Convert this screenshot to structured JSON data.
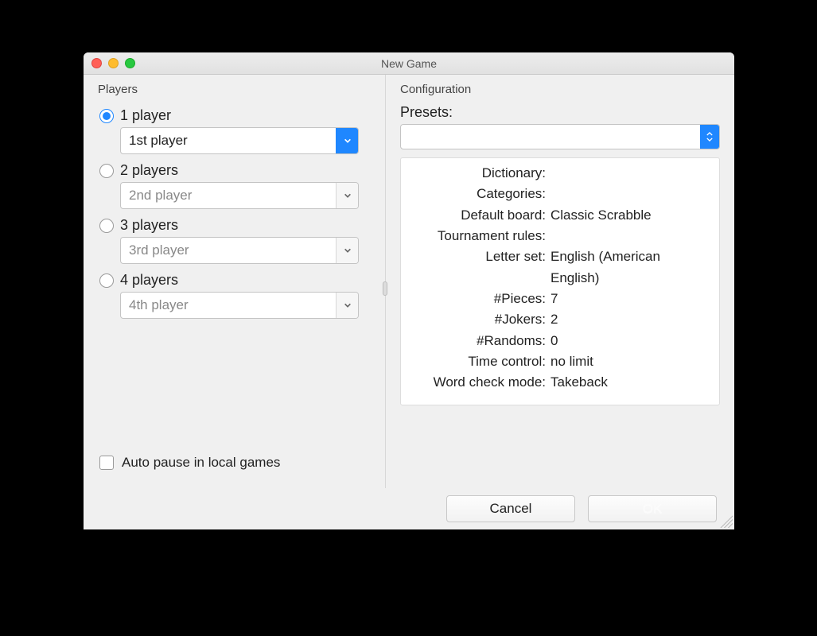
{
  "window": {
    "title": "New Game"
  },
  "players": {
    "sectionLabel": "Players",
    "options": [
      {
        "label": "1 player",
        "combo": "1st player",
        "selected": true
      },
      {
        "label": "2 players",
        "combo": "2nd player",
        "selected": false
      },
      {
        "label": "3 players",
        "combo": "3rd player",
        "selected": false
      },
      {
        "label": "4 players",
        "combo": "4th player",
        "selected": false
      }
    ],
    "autoPauseLabel": "Auto pause in local games"
  },
  "config": {
    "sectionLabel": "Configuration",
    "presetsLabel": "Presets:",
    "presetValue": "",
    "rows": [
      {
        "key": "Dictionary:",
        "val": ""
      },
      {
        "key": "Categories:",
        "val": ""
      },
      {
        "key": "Default board:",
        "val": "Classic Scrabble"
      },
      {
        "key": "Tournament rules:",
        "val": ""
      },
      {
        "key": "Letter set:",
        "val": "English (American English)"
      },
      {
        "key": "#Pieces:",
        "val": "7"
      },
      {
        "key": "#Jokers:",
        "val": "2"
      },
      {
        "key": "#Randoms:",
        "val": "0"
      },
      {
        "key": "Time control:",
        "val": "no limit"
      },
      {
        "key": "Word check mode:",
        "val": "Takeback"
      }
    ]
  },
  "buttons": {
    "cancel": "Cancel",
    "ok": "OK"
  }
}
